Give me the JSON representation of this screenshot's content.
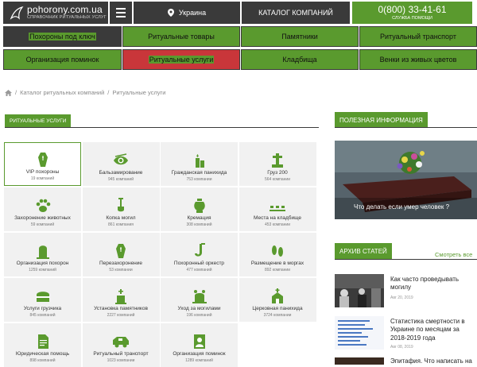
{
  "header": {
    "site_name": "pohorony.com.ua",
    "site_tagline": "СПРАВОЧНИК РИТУАЛЬНЫХ УСЛУГ",
    "region": "Украина",
    "catalog_label": "КАТАЛОГ КОМПАНИЙ",
    "phone": "0(800) 33-41-61",
    "phone_label": "СЛУЖБА ПОМОЩИ"
  },
  "menu": [
    {
      "label": "Похороны под ключ",
      "style": "dark"
    },
    {
      "label": "Ритуальные товары",
      "style": "green"
    },
    {
      "label": "Памятники",
      "style": "green"
    },
    {
      "label": "Ритуальный транспорт",
      "style": "green"
    },
    {
      "label": "Организация поминок",
      "style": "green"
    },
    {
      "label": "Ритуальные услуги",
      "style": "red"
    },
    {
      "label": "Кладбища",
      "style": "green"
    },
    {
      "label": "Венки из живых цветов",
      "style": "green"
    }
  ],
  "breadcrumb": {
    "home_icon": "home-icon",
    "items": [
      "Каталог ритуальных компаний",
      "Ритуальные услуги"
    ],
    "separator": "/"
  },
  "section_title": "РИТУАЛЬНЫЕ УСЛУГИ",
  "services": [
    {
      "title": "VIP похороны",
      "count": "19 компаний",
      "icon": "coffin-icon"
    },
    {
      "title": "Бальзамирование",
      "count": "945 компаний",
      "icon": "eye-icon"
    },
    {
      "title": "Гражданская панихида",
      "count": "753 компании",
      "icon": "candle-icon"
    },
    {
      "title": "Груз 200",
      "count": "564 компании",
      "icon": "cross-icon"
    },
    {
      "title": "Захоронение животных",
      "count": "59 компаний",
      "icon": "paw-icon"
    },
    {
      "title": "Копка могил",
      "count": "861 компания",
      "icon": "shovel-icon"
    },
    {
      "title": "Кремация",
      "count": "308 компаний",
      "icon": "urn-icon"
    },
    {
      "title": "Места на кладбище",
      "count": "453 компании",
      "icon": "graves-icon"
    },
    {
      "title": "Организация похорон",
      "count": "1259 компаний",
      "icon": "tombstone-icon"
    },
    {
      "title": "Перезахоронение",
      "count": "53 компании",
      "icon": "coffin-icon"
    },
    {
      "title": "Похоронный оркестр",
      "count": "477 компаний",
      "icon": "saxophone-icon"
    },
    {
      "title": "Размещение в моргах",
      "count": "892 компании",
      "icon": "feet-icon"
    },
    {
      "title": "Услуги грузчика",
      "count": "845 компаний",
      "icon": "casket-icon"
    },
    {
      "title": "Установка памятников",
      "count": "2227 компаний",
      "icon": "monument-icon"
    },
    {
      "title": "Уход за могилами",
      "count": "196 компаний",
      "icon": "grave-care-icon"
    },
    {
      "title": "Церковная панихида",
      "count": "3724 компании",
      "icon": "church-icon"
    },
    {
      "title": "Юридическая помощь",
      "count": "898 компаний",
      "icon": "document-icon"
    },
    {
      "title": "Ритуальный транспорт",
      "count": "1023 компании",
      "icon": "hearse-icon"
    },
    {
      "title": "Организация поминок",
      "count": "1289 компаний",
      "icon": "portrait-icon"
    }
  ],
  "sidebar": {
    "useful_title": "ПОЛЕЗНАЯ ИНФОРМАЦИЯ",
    "useful_caption": "Что делать если умер человек ?",
    "archive_title": "АРХИВ СТАТЕЙ",
    "see_all": "Смотреть все",
    "articles": [
      {
        "title": "Как часто проведывать могилу",
        "date": "Авг 20, 2019"
      },
      {
        "title": "Статистика смертности в Украине по месяцам за 2018-2019 года",
        "date": "Авг 08, 2019"
      },
      {
        "title": "Эпитафия. Что написать на",
        "date": ""
      }
    ]
  },
  "colors": {
    "accent": "#5a9a2e",
    "dark": "#3a3a3a",
    "red": "#c9363a"
  }
}
